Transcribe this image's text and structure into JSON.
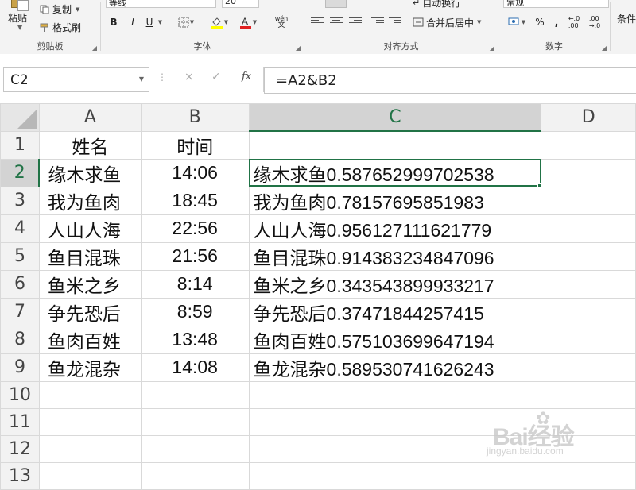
{
  "ribbon": {
    "clipboard": {
      "paste": "粘贴",
      "copy": "复制",
      "format_painter": "格式刷",
      "label": "剪贴板"
    },
    "font": {
      "font_name": "等线",
      "font_size": "20",
      "bold": "B",
      "italic": "I",
      "underline": "U",
      "label": "字体",
      "wen": "wén",
      "wen2": "文"
    },
    "alignment": {
      "merge_center": "合并后居中",
      "wrap_text": "自动换行",
      "label": "对齐方式"
    },
    "number": {
      "format": "常规",
      "percent": "%",
      "comma": ",",
      "label": "数字"
    },
    "styles": {
      "conditional": "条件"
    }
  },
  "formula_bar": {
    "name_box": "C2",
    "cancel": "×",
    "enter": "✓",
    "fx": "fx",
    "formula": "=A2&B2"
  },
  "sheet": {
    "columns": [
      {
        "label": "A",
        "selected": false
      },
      {
        "label": "B",
        "selected": false
      },
      {
        "label": "C",
        "selected": true
      },
      {
        "label": "D",
        "selected": false
      }
    ],
    "rows": [
      {
        "num": "1",
        "a": "姓名",
        "b": "时间",
        "c": ""
      },
      {
        "num": "2",
        "a": "缘木求鱼",
        "b": "14:06",
        "c": "缘木求鱼0.587652999702538"
      },
      {
        "num": "3",
        "a": "我为鱼肉",
        "b": "18:45",
        "c": "我为鱼肉0.78157695851983"
      },
      {
        "num": "4",
        "a": "人山人海",
        "b": "22:56",
        "c": "人山人海0.956127111621779"
      },
      {
        "num": "5",
        "a": "鱼目混珠",
        "b": "21:56",
        "c": "鱼目混珠0.914383234847096"
      },
      {
        "num": "6",
        "a": "鱼米之乡",
        "b": "8:14",
        "c": "鱼米之乡0.343543899933217"
      },
      {
        "num": "7",
        "a": "争先恐后",
        "b": "8:59",
        "c": "争先恐后0.37471844257415"
      },
      {
        "num": "8",
        "a": "鱼肉百姓",
        "b": "13:48",
        "c": "鱼肉百姓0.575103699647194"
      },
      {
        "num": "9",
        "a": "鱼龙混杂",
        "b": "14:08",
        "c": "鱼龙混杂0.589530741626243"
      },
      {
        "num": "10",
        "a": "",
        "b": "",
        "c": ""
      },
      {
        "num": "11",
        "a": "",
        "b": "",
        "c": ""
      },
      {
        "num": "12",
        "a": "",
        "b": "",
        "c": ""
      },
      {
        "num": "13",
        "a": "",
        "b": "",
        "c": ""
      }
    ],
    "active_cell": "C2"
  },
  "watermark": {
    "main": "Bai经验",
    "sub": "jingyan.baidu.com"
  },
  "colors": {
    "accent": "#217346",
    "header_bg": "#f2f2f2",
    "selected_header_bg": "#d3d3d3",
    "font_color_bar": "#e02020",
    "highlight_bar": "#ffff00"
  }
}
